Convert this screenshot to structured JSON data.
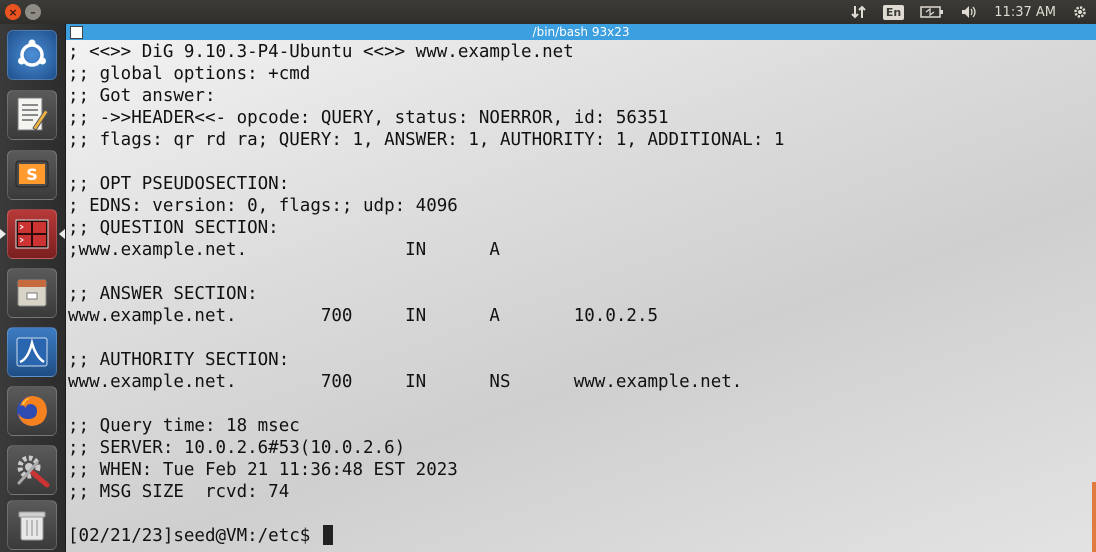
{
  "top_panel": {
    "clock": "11:37 AM",
    "keyboard_layout": "En",
    "icons": [
      "network-transfer-icon",
      "battery-icon",
      "volume-icon",
      "settings-gear-icon"
    ]
  },
  "launcher": {
    "items": [
      {
        "name": "ubuntu-dash-icon"
      },
      {
        "name": "text-editor-icon"
      },
      {
        "name": "sublime-text-icon"
      },
      {
        "name": "terminal-icon",
        "active": true
      },
      {
        "name": "file-manager-icon"
      },
      {
        "name": "wireshark-icon"
      },
      {
        "name": "firefox-icon"
      },
      {
        "name": "system-settings-icon"
      },
      {
        "name": "trash-icon"
      }
    ]
  },
  "terminal": {
    "title": "/bin/bash 93x23",
    "lines": [
      "; <<>> DiG 9.10.3-P4-Ubuntu <<>> www.example.net",
      ";; global options: +cmd",
      ";; Got answer:",
      ";; ->>HEADER<<- opcode: QUERY, status: NOERROR, id: 56351",
      ";; flags: qr rd ra; QUERY: 1, ANSWER: 1, AUTHORITY: 1, ADDITIONAL: 1",
      "",
      ";; OPT PSEUDOSECTION:",
      "; EDNS: version: 0, flags:; udp: 4096",
      ";; QUESTION SECTION:",
      ";www.example.net.               IN      A",
      "",
      ";; ANSWER SECTION:",
      "www.example.net.        700     IN      A       10.0.2.5",
      "",
      ";; AUTHORITY SECTION:",
      "www.example.net.        700     IN      NS      www.example.net.",
      "",
      ";; Query time: 18 msec",
      ";; SERVER: 10.0.2.6#53(10.0.2.6)",
      ";; WHEN: Tue Feb 21 11:36:48 EST 2023",
      ";; MSG SIZE  rcvd: 74"
    ],
    "prompt": "[02/21/23]seed@VM:/etc$ "
  }
}
